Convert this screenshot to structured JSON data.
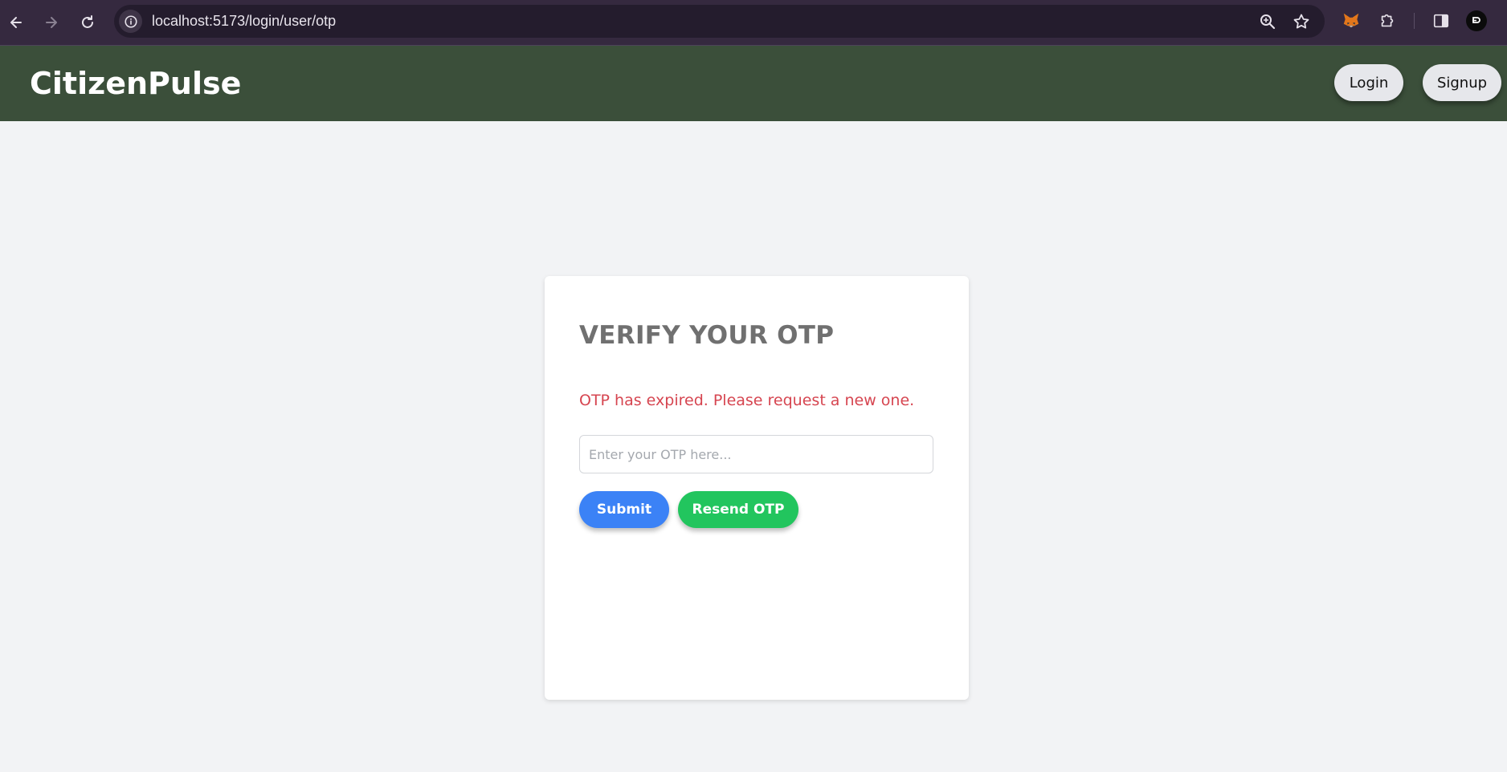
{
  "browser": {
    "url": "localhost:5173/login/user/otp",
    "icons": [
      "back-arrow-icon",
      "forward-arrow-icon",
      "reload-icon",
      "site-info-icon",
      "zoom-icon",
      "bookmark-star-icon",
      "metamask-fox-icon",
      "extensions-puzzle-icon",
      "side-panel-icon",
      "profile-icon"
    ]
  },
  "header": {
    "brand": "CitizenPulse",
    "login_label": "Login",
    "signup_label": "Signup",
    "background_color": "#3b4f3a"
  },
  "otp_form": {
    "title": "VERIFY YOUR OTP",
    "error_message": "OTP has expired. Please request a new one.",
    "input_placeholder": "Enter your OTP here...",
    "input_value": "",
    "submit_label": "Submit",
    "resend_label": "Resend OTP",
    "submit_color": "#3b82f6",
    "resend_color": "#22c55e",
    "error_color": "#d64550"
  }
}
